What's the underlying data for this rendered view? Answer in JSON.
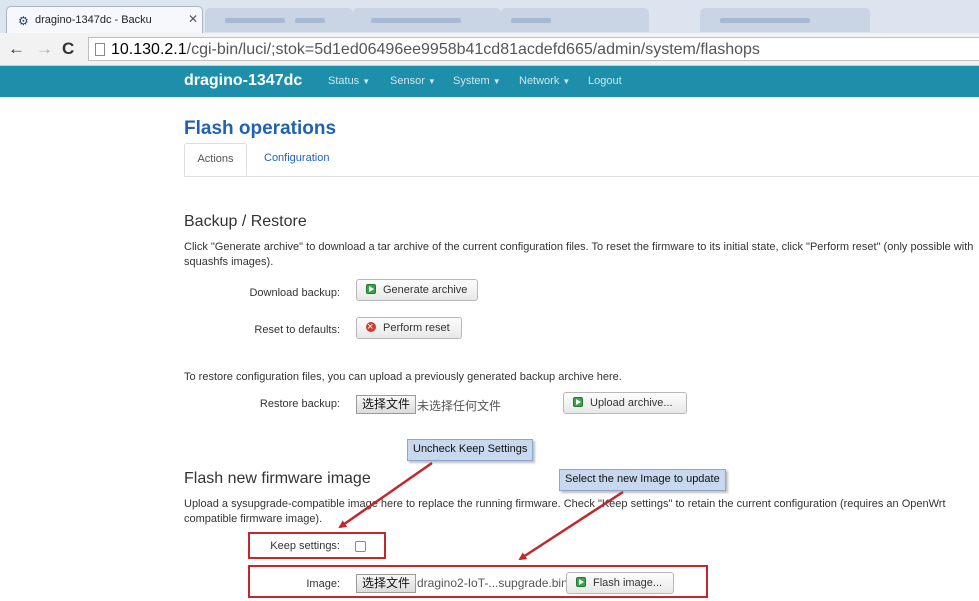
{
  "browser": {
    "tab_title": "dragino-1347dc - Backu",
    "url_host": "10.130.2.1",
    "url_path": "/cgi-bin/luci/;stok=5d1ed06496ee9958b41cd81acdefd665/admin/system/flashops"
  },
  "header": {
    "brand": "dragino-1347dc",
    "menu": [
      "Status",
      "Sensor",
      "System",
      "Network",
      "Logout"
    ]
  },
  "page": {
    "title": "Flash operations",
    "tabs": [
      "Actions",
      "Configuration"
    ]
  },
  "backup": {
    "heading": "Backup / Restore",
    "desc": "Click \"Generate archive\" to download a tar archive of the current configuration files. To reset the firmware to its initial state, click \"Perform reset\" (only possible with squashfs images).",
    "download_label": "Download backup:",
    "generate_button": "Generate archive",
    "reset_label": "Reset to defaults:",
    "reset_button": "Perform reset",
    "restore_desc": "To restore configuration files, you can upload a previously generated backup archive here.",
    "restore_label": "Restore backup:",
    "choose_file": "选择文件",
    "no_file": "未选择任何文件",
    "upload_button": "Upload archive..."
  },
  "flash": {
    "heading": "Flash new firmware image",
    "desc": "Upload a sysupgrade-compatible image here to replace the running firmware. Check \"Keep settings\" to retain the current configuration (requires an OpenWrt compatible firmware image).",
    "keep_label": "Keep settings:",
    "image_label": "Image:",
    "choose_file": "选择文件",
    "file_name": "dragino2-IoT-...supgrade.bin",
    "flash_button": "Flash image..."
  },
  "annotations": {
    "keep_callout": "Uncheck Keep Settings",
    "image_callout": "Select the new Image to update",
    "color": "#c0282d"
  }
}
